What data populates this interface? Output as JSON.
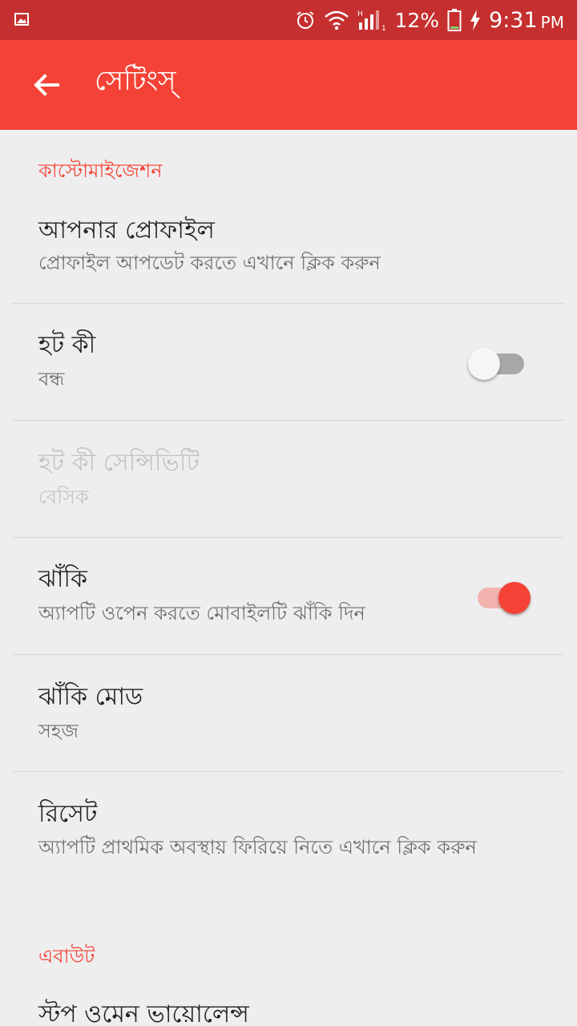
{
  "status_bar": {
    "battery_percent": "12%",
    "time": "9:31",
    "ampm": "PM",
    "icons": [
      "image-icon",
      "alarm-icon",
      "wifi-icon",
      "signal-icon",
      "battery-icon",
      "charging-icon"
    ]
  },
  "app_bar": {
    "title": "সেটিংস্",
    "back_icon": "arrow-left-icon"
  },
  "sections": {
    "customization": {
      "header": "কাস্টোমাইজেশন",
      "items": [
        {
          "title": "আপনার প্রোফাইল",
          "subtitle": "প্রোফাইল আপডেট করতে এখানে ক্লিক করুন"
        },
        {
          "title": "হট কী",
          "subtitle": "বন্ধ",
          "switch": "off"
        },
        {
          "title": "হট কী সেন্সিভিটি",
          "subtitle": "বেসিক",
          "disabled": true
        },
        {
          "title": "ঝাঁকি",
          "subtitle": "অ্যাপটি ওপেন করতে মোবাইলটি ঝাঁকি দিন",
          "switch": "on"
        },
        {
          "title": "ঝাঁকি মোড",
          "subtitle": "সহজ"
        },
        {
          "title": "রিসেট",
          "subtitle": "অ্যাপটি প্রাথমিক অবস্থায় ফিরিয়ে নিতে এখানে ক্লিক করুন"
        }
      ]
    },
    "about": {
      "header": "এবাউট",
      "items": [
        {
          "title": "স্টপ ওমেন ভায়োলেন্স"
        }
      ]
    }
  },
  "colors": {
    "status_bar": "#c62f2f",
    "app_bar": "#f44336",
    "accent": "#f44336",
    "background": "#eeeeee"
  }
}
